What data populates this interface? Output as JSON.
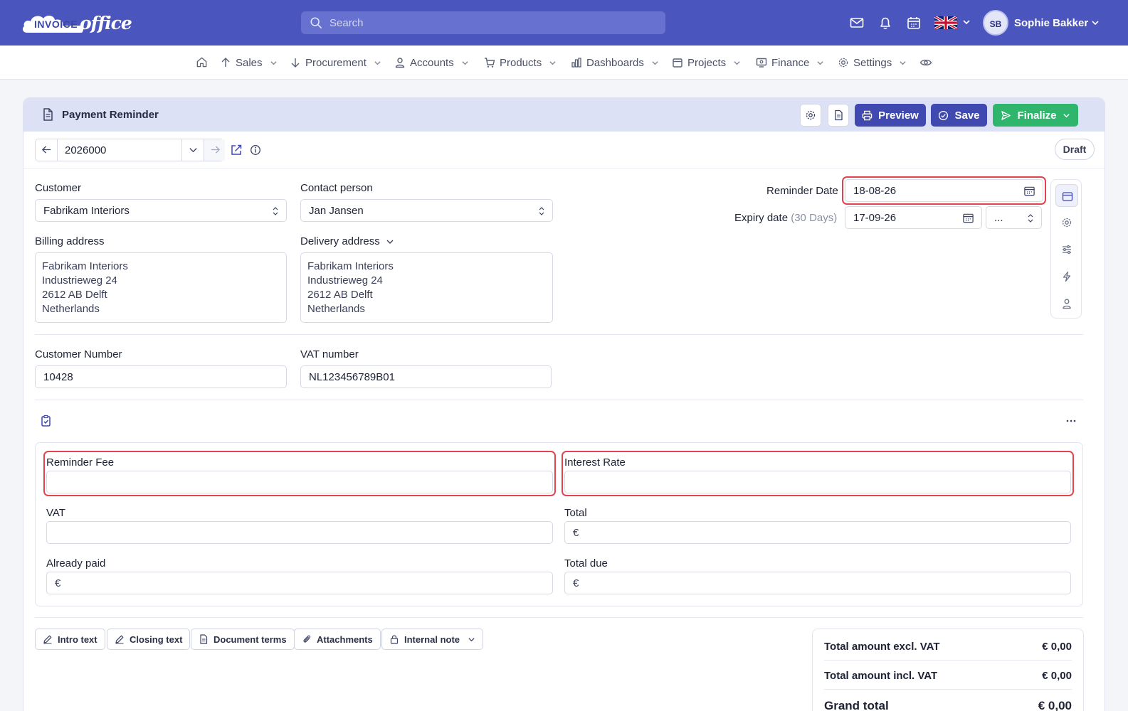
{
  "topbar": {
    "logo_invoice": "INVOICE",
    "logo_office": "office",
    "search_placeholder": "Search",
    "user_initials": "SB",
    "user_name": "Sophie Bakker"
  },
  "nav": {
    "items": [
      {
        "label": "Sales",
        "icon": "arrow-up-icon"
      },
      {
        "label": "Procurement",
        "icon": "arrow-down-icon"
      },
      {
        "label": "Accounts",
        "icon": "person-icon"
      },
      {
        "label": "Products",
        "icon": "cart-icon"
      },
      {
        "label": "Dashboards",
        "icon": "bar-chart-icon"
      },
      {
        "label": "Projects",
        "icon": "calendar-icon"
      },
      {
        "label": "Finance",
        "icon": "monitor-icon"
      },
      {
        "label": "Settings",
        "icon": "gear-icon"
      }
    ]
  },
  "header": {
    "title": "Payment Reminder",
    "preview_label": "Preview",
    "save_label": "Save",
    "finalize_label": "Finalize"
  },
  "toolbar": {
    "document_number": "2026000",
    "status": "Draft"
  },
  "form": {
    "customer_label": "Customer",
    "customer_value": "Fabrikam Interiors",
    "contact_label": "Contact person",
    "contact_value": "Jan Jansen",
    "billing_label": "Billing address",
    "billing_lines": [
      "Fabrikam Interiors",
      "Industrieweg 24",
      "2612 AB Delft",
      "Netherlands"
    ],
    "delivery_label": "Delivery address",
    "delivery_lines": [
      "Fabrikam Interiors",
      "Industrieweg 24",
      "2612 AB Delft",
      "Netherlands"
    ],
    "reminder_date_label": "Reminder Date",
    "reminder_date_value": "18-08-26",
    "expiry_label": "Expiry date",
    "expiry_days": "(30 Days)",
    "expiry_value": "17-09-26",
    "expiry_select": "...",
    "customer_number_label": "Customer Number",
    "customer_number_value": "10428",
    "vat_number_label": "VAT number",
    "vat_number_value": "NL123456789B01"
  },
  "amounts": {
    "reminder_fee_label": "Reminder Fee",
    "reminder_fee_value": "",
    "interest_rate_label": "Interest Rate",
    "interest_rate_value": "",
    "vat_label": "VAT",
    "vat_value": "",
    "total_label": "Total",
    "already_paid_label": "Already paid",
    "total_due_label": "Total due",
    "currency_symbol": "€"
  },
  "bottom_buttons": {
    "intro_text": "Intro text",
    "closing_text": "Closing text",
    "document_terms": "Document terms",
    "attachments": "Attachments",
    "internal_note": "Internal note"
  },
  "summary": {
    "rows": [
      {
        "label": "Total amount excl. VAT",
        "value": "€ 0,00"
      },
      {
        "label": "Total amount incl. VAT",
        "value": "€ 0,00"
      },
      {
        "label": "Grand total",
        "value": "€ 0,00"
      }
    ]
  },
  "colors": {
    "topbar": "#4a55bd",
    "primary_button": "#3f49b0",
    "finalize_button": "#2fb56c",
    "highlight": "#e04450"
  }
}
